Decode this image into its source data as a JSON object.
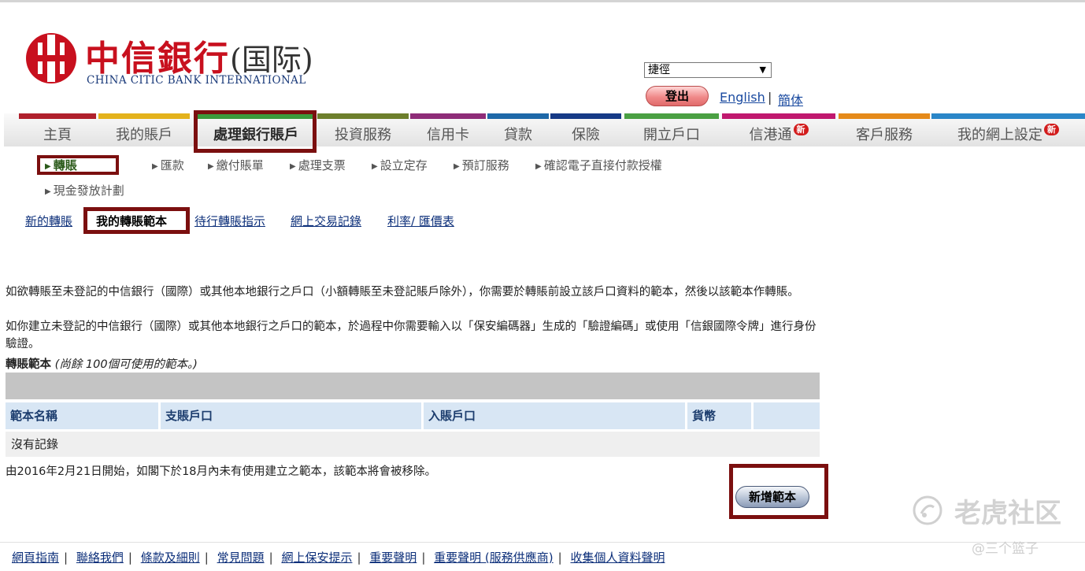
{
  "brand": {
    "name_cn": "中信銀行",
    "name_cn_paren": "(国际)",
    "name_en": "CHINA CITIC BANK INTERNATIONAL"
  },
  "header": {
    "shortcut_select": {
      "selected": "捷徑"
    },
    "logout_label": "登出",
    "lang_english": "English",
    "lang_separator": "|",
    "lang_simplified": "簡体"
  },
  "main_nav": {
    "items": [
      {
        "label": "主頁",
        "color": "#b0202c"
      },
      {
        "label": "我的賬戶",
        "color": "#e3b21c"
      },
      {
        "label": "處理銀行賬戶",
        "color": "#3b9a3b",
        "active": true
      },
      {
        "label": "投資服務",
        "color": "#6d7f2c"
      },
      {
        "label": "信用卡",
        "color": "#8e2c78"
      },
      {
        "label": "貸款",
        "color": "#1e68a8"
      },
      {
        "label": "保險",
        "color": "#163a86"
      },
      {
        "label": "開立戶口",
        "color": "#4aa043"
      },
      {
        "label": "信港通",
        "color": "#c0186e",
        "badge": "新"
      },
      {
        "label": "客戶服務",
        "color": "#e58a1a"
      },
      {
        "label": "我的網上設定",
        "color": "#2a86c8",
        "badge": "新"
      }
    ]
  },
  "sub_nav": {
    "items": [
      {
        "label": "轉賬",
        "active": true
      },
      {
        "label": "匯款"
      },
      {
        "label": "繳付賬單"
      },
      {
        "label": "處理支票"
      },
      {
        "label": "設立定存"
      },
      {
        "label": "預訂服務"
      },
      {
        "label": "確認電子直接付款授權"
      },
      {
        "label": "現金發放計劃"
      }
    ]
  },
  "tabs": {
    "items": [
      {
        "label": "新的轉賬"
      },
      {
        "label": "我的轉賬範本",
        "active": true
      },
      {
        "label": "待行轉賬指示"
      },
      {
        "label": "網上交易記錄"
      },
      {
        "label": "利率/ 匯價表"
      }
    ]
  },
  "description": {
    "para1": "如欲轉賬至未登記的中信銀行（國際）或其他本地銀行之戶口（小額轉賬至未登記賬戶除外），你需要於轉賬前設立該戶口資料的範本，然後以該範本作轉賬。",
    "para2": "如你建立未登記的中信銀行（國際）或其他本地銀行之戶口的範本，於過程中你需要輸入以「保安編碼器」生成的「驗證編碼」或使用「信銀國際令牌」進行身份驗證。"
  },
  "templates": {
    "label": "轉賬範本",
    "remaining_note": "(尚餘 100個可使用的範本。)",
    "columns": [
      "範本名稱",
      "支賬戶口",
      "入賬戶口",
      "貨幣",
      ""
    ],
    "no_records": "沒有記錄",
    "removal_notice": "由2016年2月21日開始，如閣下於18月內未有使用建立之範本，該範本將會被移除。",
    "add_button_label": "新增範本"
  },
  "footer": {
    "links": [
      "網頁指南",
      "聯絡我們",
      "條款及細則",
      "常見問題",
      "網上保安提示",
      "重要聲明",
      "重要聲明 (服務供應商)",
      "收集個人資料聲明"
    ],
    "separator": "|"
  },
  "watermark": {
    "text": "老虎社区",
    "sub": "@三个篮子"
  }
}
